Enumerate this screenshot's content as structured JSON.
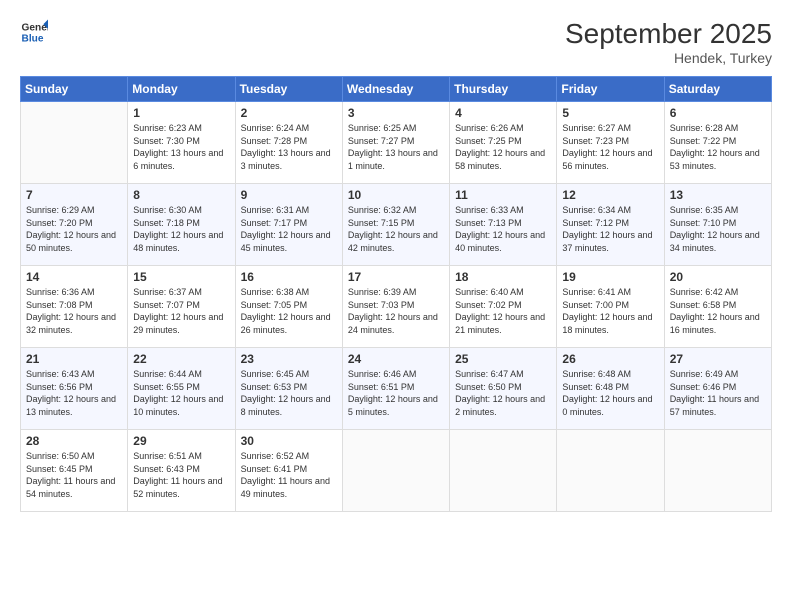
{
  "logo": {
    "line1": "General",
    "line2": "Blue"
  },
  "title": "September 2025",
  "subtitle": "Hendek, Turkey",
  "days_header": [
    "Sunday",
    "Monday",
    "Tuesday",
    "Wednesday",
    "Thursday",
    "Friday",
    "Saturday"
  ],
  "weeks": [
    [
      {
        "day": "",
        "sunrise": "",
        "sunset": "",
        "daylight": ""
      },
      {
        "day": "1",
        "sunrise": "Sunrise: 6:23 AM",
        "sunset": "Sunset: 7:30 PM",
        "daylight": "Daylight: 13 hours and 6 minutes."
      },
      {
        "day": "2",
        "sunrise": "Sunrise: 6:24 AM",
        "sunset": "Sunset: 7:28 PM",
        "daylight": "Daylight: 13 hours and 3 minutes."
      },
      {
        "day": "3",
        "sunrise": "Sunrise: 6:25 AM",
        "sunset": "Sunset: 7:27 PM",
        "daylight": "Daylight: 13 hours and 1 minute."
      },
      {
        "day": "4",
        "sunrise": "Sunrise: 6:26 AM",
        "sunset": "Sunset: 7:25 PM",
        "daylight": "Daylight: 12 hours and 58 minutes."
      },
      {
        "day": "5",
        "sunrise": "Sunrise: 6:27 AM",
        "sunset": "Sunset: 7:23 PM",
        "daylight": "Daylight: 12 hours and 56 minutes."
      },
      {
        "day": "6",
        "sunrise": "Sunrise: 6:28 AM",
        "sunset": "Sunset: 7:22 PM",
        "daylight": "Daylight: 12 hours and 53 minutes."
      }
    ],
    [
      {
        "day": "7",
        "sunrise": "Sunrise: 6:29 AM",
        "sunset": "Sunset: 7:20 PM",
        "daylight": "Daylight: 12 hours and 50 minutes."
      },
      {
        "day": "8",
        "sunrise": "Sunrise: 6:30 AM",
        "sunset": "Sunset: 7:18 PM",
        "daylight": "Daylight: 12 hours and 48 minutes."
      },
      {
        "day": "9",
        "sunrise": "Sunrise: 6:31 AM",
        "sunset": "Sunset: 7:17 PM",
        "daylight": "Daylight: 12 hours and 45 minutes."
      },
      {
        "day": "10",
        "sunrise": "Sunrise: 6:32 AM",
        "sunset": "Sunset: 7:15 PM",
        "daylight": "Daylight: 12 hours and 42 minutes."
      },
      {
        "day": "11",
        "sunrise": "Sunrise: 6:33 AM",
        "sunset": "Sunset: 7:13 PM",
        "daylight": "Daylight: 12 hours and 40 minutes."
      },
      {
        "day": "12",
        "sunrise": "Sunrise: 6:34 AM",
        "sunset": "Sunset: 7:12 PM",
        "daylight": "Daylight: 12 hours and 37 minutes."
      },
      {
        "day": "13",
        "sunrise": "Sunrise: 6:35 AM",
        "sunset": "Sunset: 7:10 PM",
        "daylight": "Daylight: 12 hours and 34 minutes."
      }
    ],
    [
      {
        "day": "14",
        "sunrise": "Sunrise: 6:36 AM",
        "sunset": "Sunset: 7:08 PM",
        "daylight": "Daylight: 12 hours and 32 minutes."
      },
      {
        "day": "15",
        "sunrise": "Sunrise: 6:37 AM",
        "sunset": "Sunset: 7:07 PM",
        "daylight": "Daylight: 12 hours and 29 minutes."
      },
      {
        "day": "16",
        "sunrise": "Sunrise: 6:38 AM",
        "sunset": "Sunset: 7:05 PM",
        "daylight": "Daylight: 12 hours and 26 minutes."
      },
      {
        "day": "17",
        "sunrise": "Sunrise: 6:39 AM",
        "sunset": "Sunset: 7:03 PM",
        "daylight": "Daylight: 12 hours and 24 minutes."
      },
      {
        "day": "18",
        "sunrise": "Sunrise: 6:40 AM",
        "sunset": "Sunset: 7:02 PM",
        "daylight": "Daylight: 12 hours and 21 minutes."
      },
      {
        "day": "19",
        "sunrise": "Sunrise: 6:41 AM",
        "sunset": "Sunset: 7:00 PM",
        "daylight": "Daylight: 12 hours and 18 minutes."
      },
      {
        "day": "20",
        "sunrise": "Sunrise: 6:42 AM",
        "sunset": "Sunset: 6:58 PM",
        "daylight": "Daylight: 12 hours and 16 minutes."
      }
    ],
    [
      {
        "day": "21",
        "sunrise": "Sunrise: 6:43 AM",
        "sunset": "Sunset: 6:56 PM",
        "daylight": "Daylight: 12 hours and 13 minutes."
      },
      {
        "day": "22",
        "sunrise": "Sunrise: 6:44 AM",
        "sunset": "Sunset: 6:55 PM",
        "daylight": "Daylight: 12 hours and 10 minutes."
      },
      {
        "day": "23",
        "sunrise": "Sunrise: 6:45 AM",
        "sunset": "Sunset: 6:53 PM",
        "daylight": "Daylight: 12 hours and 8 minutes."
      },
      {
        "day": "24",
        "sunrise": "Sunrise: 6:46 AM",
        "sunset": "Sunset: 6:51 PM",
        "daylight": "Daylight: 12 hours and 5 minutes."
      },
      {
        "day": "25",
        "sunrise": "Sunrise: 6:47 AM",
        "sunset": "Sunset: 6:50 PM",
        "daylight": "Daylight: 12 hours and 2 minutes."
      },
      {
        "day": "26",
        "sunrise": "Sunrise: 6:48 AM",
        "sunset": "Sunset: 6:48 PM",
        "daylight": "Daylight: 12 hours and 0 minutes."
      },
      {
        "day": "27",
        "sunrise": "Sunrise: 6:49 AM",
        "sunset": "Sunset: 6:46 PM",
        "daylight": "Daylight: 11 hours and 57 minutes."
      }
    ],
    [
      {
        "day": "28",
        "sunrise": "Sunrise: 6:50 AM",
        "sunset": "Sunset: 6:45 PM",
        "daylight": "Daylight: 11 hours and 54 minutes."
      },
      {
        "day": "29",
        "sunrise": "Sunrise: 6:51 AM",
        "sunset": "Sunset: 6:43 PM",
        "daylight": "Daylight: 11 hours and 52 minutes."
      },
      {
        "day": "30",
        "sunrise": "Sunrise: 6:52 AM",
        "sunset": "Sunset: 6:41 PM",
        "daylight": "Daylight: 11 hours and 49 minutes."
      },
      {
        "day": "",
        "sunrise": "",
        "sunset": "",
        "daylight": ""
      },
      {
        "day": "",
        "sunrise": "",
        "sunset": "",
        "daylight": ""
      },
      {
        "day": "",
        "sunrise": "",
        "sunset": "",
        "daylight": ""
      },
      {
        "day": "",
        "sunrise": "",
        "sunset": "",
        "daylight": ""
      }
    ]
  ]
}
